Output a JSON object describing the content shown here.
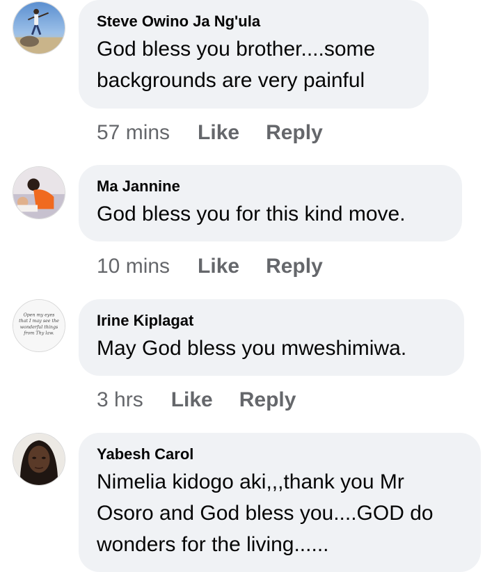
{
  "comments": [
    {
      "author": "Steve Owino Ja Ng'ula",
      "text": "God bless you brother....some backgrounds are very painful",
      "time": "57 mins",
      "like": "Like",
      "reply": "Reply"
    },
    {
      "author": "Ma Jannine",
      "text": "God bless you for this kind move.",
      "time": "10 mins",
      "like": "Like",
      "reply": "Reply"
    },
    {
      "author": "Irine Kiplagat",
      "text": "May God bless you mweshimiwa.",
      "time": "3 hrs",
      "like": "Like",
      "reply": "Reply",
      "avatar_text": "Open my eyes that I may see the wonderful things from Thy law."
    },
    {
      "author": "Yabesh Carol",
      "text": "Nimelia kidogo  aki,,,thank you Mr Osoro and God bless you....GOD do wonders for the living......"
    }
  ]
}
